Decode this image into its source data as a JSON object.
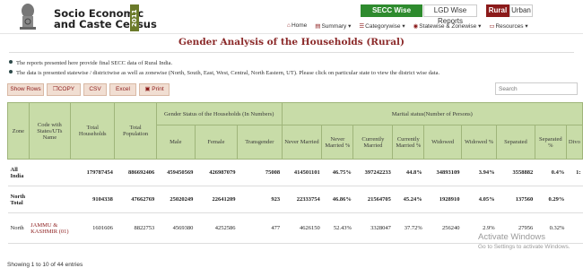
{
  "header": {
    "logo_line1": "Socio Economic",
    "logo_line2": "and Caste Census",
    "logo_year": "2011"
  },
  "report_buttons": {
    "secc": "SECC Wise Reports",
    "lgd": "LGD Wise Reports",
    "rural": "Rural",
    "urban": "Urban"
  },
  "nav": {
    "home": "Home",
    "summary": "Summary",
    "categorywise": "Categorywise",
    "statewise": "Statewise & Zonewise",
    "resources": "Resources"
  },
  "title": "Gender Analysis of the Households (Rural)",
  "notes": [
    "The reports presented here provide final SECC data of Rural India.",
    "The data is presented statewise / districtwise as well as zonewise (North, South, East, West, Central, North Eastern, UT). Please click on particular state to view the district wise data."
  ],
  "toolbar": {
    "show_rows": "Show Rows",
    "copy": "COPY",
    "csv": "CSV",
    "excel": "Excel",
    "print": "Print"
  },
  "search": {
    "placeholder": "Search"
  },
  "table": {
    "headers": {
      "zone": "Zone",
      "code": "Code with States/UTs Name",
      "total_households": "Total Households",
      "total_population": "Total Population",
      "gender_status": "Gender Status of the Households (In Numbers)",
      "marital_status": "Marital status(Number of Persons)",
      "male": "Male",
      "female": "Female",
      "transgender": "Transgender",
      "never_married": "Never Married",
      "never_married_pct": "Never Married %",
      "currently_married": "Currently Married",
      "currently_married_pct": "Currently Married %",
      "widowed": "Widowed",
      "widowed_pct": "Widowed %",
      "separated": "Separated",
      "separated_pct": "Separated %",
      "divorced": "Divo"
    },
    "rows": [
      {
        "zone": "All India",
        "state": "",
        "households": "179787454",
        "population": "886692406",
        "male": "459450569",
        "female": "426987079",
        "transgender": "75008",
        "never_married": "414501101",
        "never_married_pct": "46.75%",
        "currently_married": "397242233",
        "currently_married_pct": "44.8%",
        "widowed": "34893109",
        "widowed_pct": "3.94%",
        "separated": "3558882",
        "separated_pct": "0.4%",
        "divorced": "1:"
      },
      {
        "zone": "North Total",
        "state": "",
        "households": "9104338",
        "population": "47662769",
        "male": "25020249",
        "female": "22641209",
        "transgender": "923",
        "never_married": "22333754",
        "never_married_pct": "46.86%",
        "currently_married": "21564705",
        "currently_married_pct": "45.24%",
        "widowed": "1928910",
        "widowed_pct": "4.05%",
        "separated": "137560",
        "separated_pct": "0.29%",
        "divorced": ""
      },
      {
        "zone": "North",
        "state": "JAMMU & KASHMIR (01)",
        "households": "1601606",
        "population": "8822753",
        "male": "4569380",
        "female": "4252586",
        "transgender": "477",
        "never_married": "4626150",
        "never_married_pct": "52.43%",
        "currently_married": "3328047",
        "currently_married_pct": "37.72%",
        "widowed": "256240",
        "widowed_pct": "2.9%",
        "separated": "27956",
        "separated_pct": "0.32%",
        "divorced": ""
      }
    ]
  },
  "footer": "Showing 1 to 10 of 44 entries",
  "watermark": {
    "line1": "Activate Windows",
    "line2": "Go to Settings to activate Windows."
  }
}
